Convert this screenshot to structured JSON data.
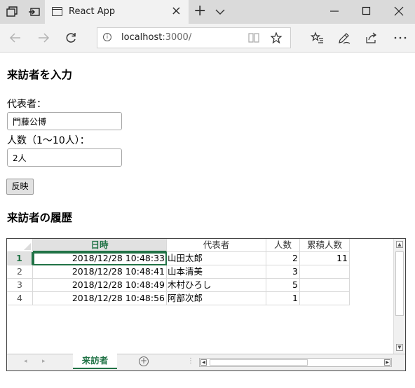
{
  "browser": {
    "tab_title": "React App",
    "url_host": "localhost",
    "url_rest": ":3000/"
  },
  "form": {
    "heading": "来訪者を入力",
    "rep_label": "代表者：",
    "rep_value": "門藤公博",
    "count_label": "人数（1～10人）：",
    "count_value": "2人",
    "submit_label": "反映"
  },
  "history": {
    "heading": "来訪者の履歴"
  },
  "sheet": {
    "columns": [
      "日時",
      "代表者",
      "人数",
      "累積人数"
    ],
    "rows": [
      {
        "num": "1",
        "datetime": "2018/12/28 10:48:33",
        "rep": "山田太郎",
        "count": "2",
        "total": "11"
      },
      {
        "num": "2",
        "datetime": "2018/12/28 10:48:41",
        "rep": "山本清美",
        "count": "3",
        "total": ""
      },
      {
        "num": "3",
        "datetime": "2018/12/28 10:48:49",
        "rep": "木村ひろし",
        "count": "5",
        "total": ""
      },
      {
        "num": "4",
        "datetime": "2018/12/28 10:48:56",
        "rep": "阿部次郎",
        "count": "1",
        "total": ""
      }
    ],
    "tab_name": "来訪者"
  },
  "colors": {
    "accent": "#217346",
    "titlebar": "#dadada"
  }
}
